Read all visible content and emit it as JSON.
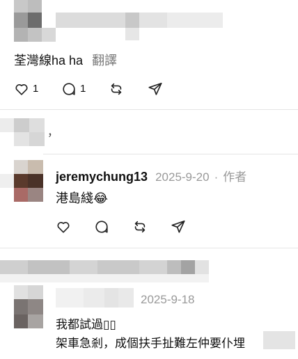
{
  "post1": {
    "text": "荃灣線ha ha",
    "translate_label": "翻譯",
    "like_count": "1",
    "reply_count": "1"
  },
  "post2": {
    "partial_text": "，"
  },
  "reply": {
    "username": "jeremychung13",
    "timestamp": "2025-9-20",
    "separator": "·",
    "author_badge": "作者",
    "text": "港島綫😂"
  },
  "post3": {
    "timestamp": "2025-9-18",
    "line1": "我都試過▯▯",
    "line2": "架車急剎，成個扶手扯難左仲要仆埋"
  },
  "icons": {
    "like": "heart-icon",
    "reply": "comment-icon",
    "repost": "repost-icon",
    "share": "send-icon"
  }
}
